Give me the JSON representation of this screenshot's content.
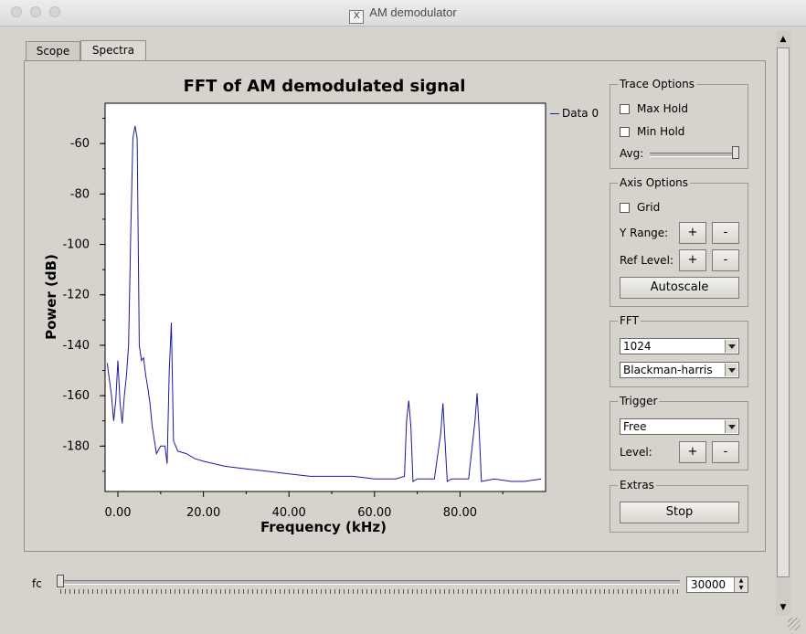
{
  "window": {
    "title": "AM demodulator"
  },
  "tabs": [
    {
      "label": "Scope"
    },
    {
      "label": "Spectra"
    }
  ],
  "plot": {
    "title": "FFT of AM demodulated signal",
    "legend": "Data 0",
    "xlabel": "Frequency (kHz)",
    "ylabel": "Power (dB)",
    "trace_color": "#1a1aa0"
  },
  "chart_data": {
    "type": "line",
    "title": "FFT of AM demodulated signal",
    "xlabel": "Frequency (kHz)",
    "ylabel": "Power (dB)",
    "xlim": [
      -3,
      100
    ],
    "ylim": [
      -198,
      -44
    ],
    "x_ticks": [
      "0.00",
      "20.00",
      "40.00",
      "60.00",
      "80.00"
    ],
    "y_ticks": [
      "-60",
      "-80",
      "-100",
      "-120",
      "-140",
      "-160",
      "-180"
    ],
    "grid": false,
    "legend_position": "top-right",
    "series": [
      {
        "name": "Data 0",
        "x": [
          -2.5,
          -1.5,
          -1,
          -0.5,
          0,
          0.5,
          1,
          1.5,
          2,
          2.5,
          3,
          3.5,
          4,
          4.5,
          5,
          5.5,
          6,
          6.5,
          7,
          7.5,
          8,
          9,
          10,
          11,
          11.5,
          12,
          12.5,
          13,
          14,
          16,
          18,
          20,
          25,
          30,
          35,
          40,
          45,
          50,
          55,
          60,
          65,
          67,
          67.5,
          68,
          68.5,
          69,
          70,
          74,
          75.5,
          76,
          76.5,
          77,
          78,
          82,
          83.5,
          84,
          84.5,
          85,
          88,
          92,
          95,
          99
        ],
        "y": [
          -147,
          -160,
          -170,
          -162,
          -146,
          -163,
          -171,
          -160,
          -152,
          -140,
          -95,
          -58,
          -53,
          -58,
          -140,
          -146,
          -145,
          -152,
          -157,
          -163,
          -172,
          -183,
          -180,
          -180,
          -187,
          -150,
          -131,
          -178,
          -182,
          -183,
          -185,
          -186,
          -188,
          -189,
          -190,
          -191,
          -192,
          -192,
          -192,
          -193,
          -193,
          -192,
          -170,
          -162,
          -172,
          -194,
          -193,
          -193,
          -175,
          -163,
          -178,
          -194,
          -193,
          -193,
          -170,
          -159,
          -175,
          -194,
          -193,
          -194,
          -194,
          -193
        ]
      }
    ]
  },
  "trace_options": {
    "title": "Trace Options",
    "max_hold": "Max Hold",
    "min_hold": "Min Hold",
    "avg_label": "Avg:",
    "avg_value": 1.0
  },
  "axis_options": {
    "title": "Axis Options",
    "grid": "Grid",
    "y_range": "Y Range:",
    "ref_level": "Ref Level:",
    "plus": "+",
    "minus": "-",
    "autoscale": "Autoscale"
  },
  "fft": {
    "title": "FFT",
    "size": "1024",
    "window": "Blackman-harris"
  },
  "trigger": {
    "title": "Trigger",
    "mode": "Free",
    "level": "Level:",
    "plus": "+",
    "minus": "-"
  },
  "extras": {
    "title": "Extras",
    "stop": "Stop"
  },
  "fc": {
    "label": "fc",
    "value": "30000",
    "slider_fraction": 0.0
  }
}
